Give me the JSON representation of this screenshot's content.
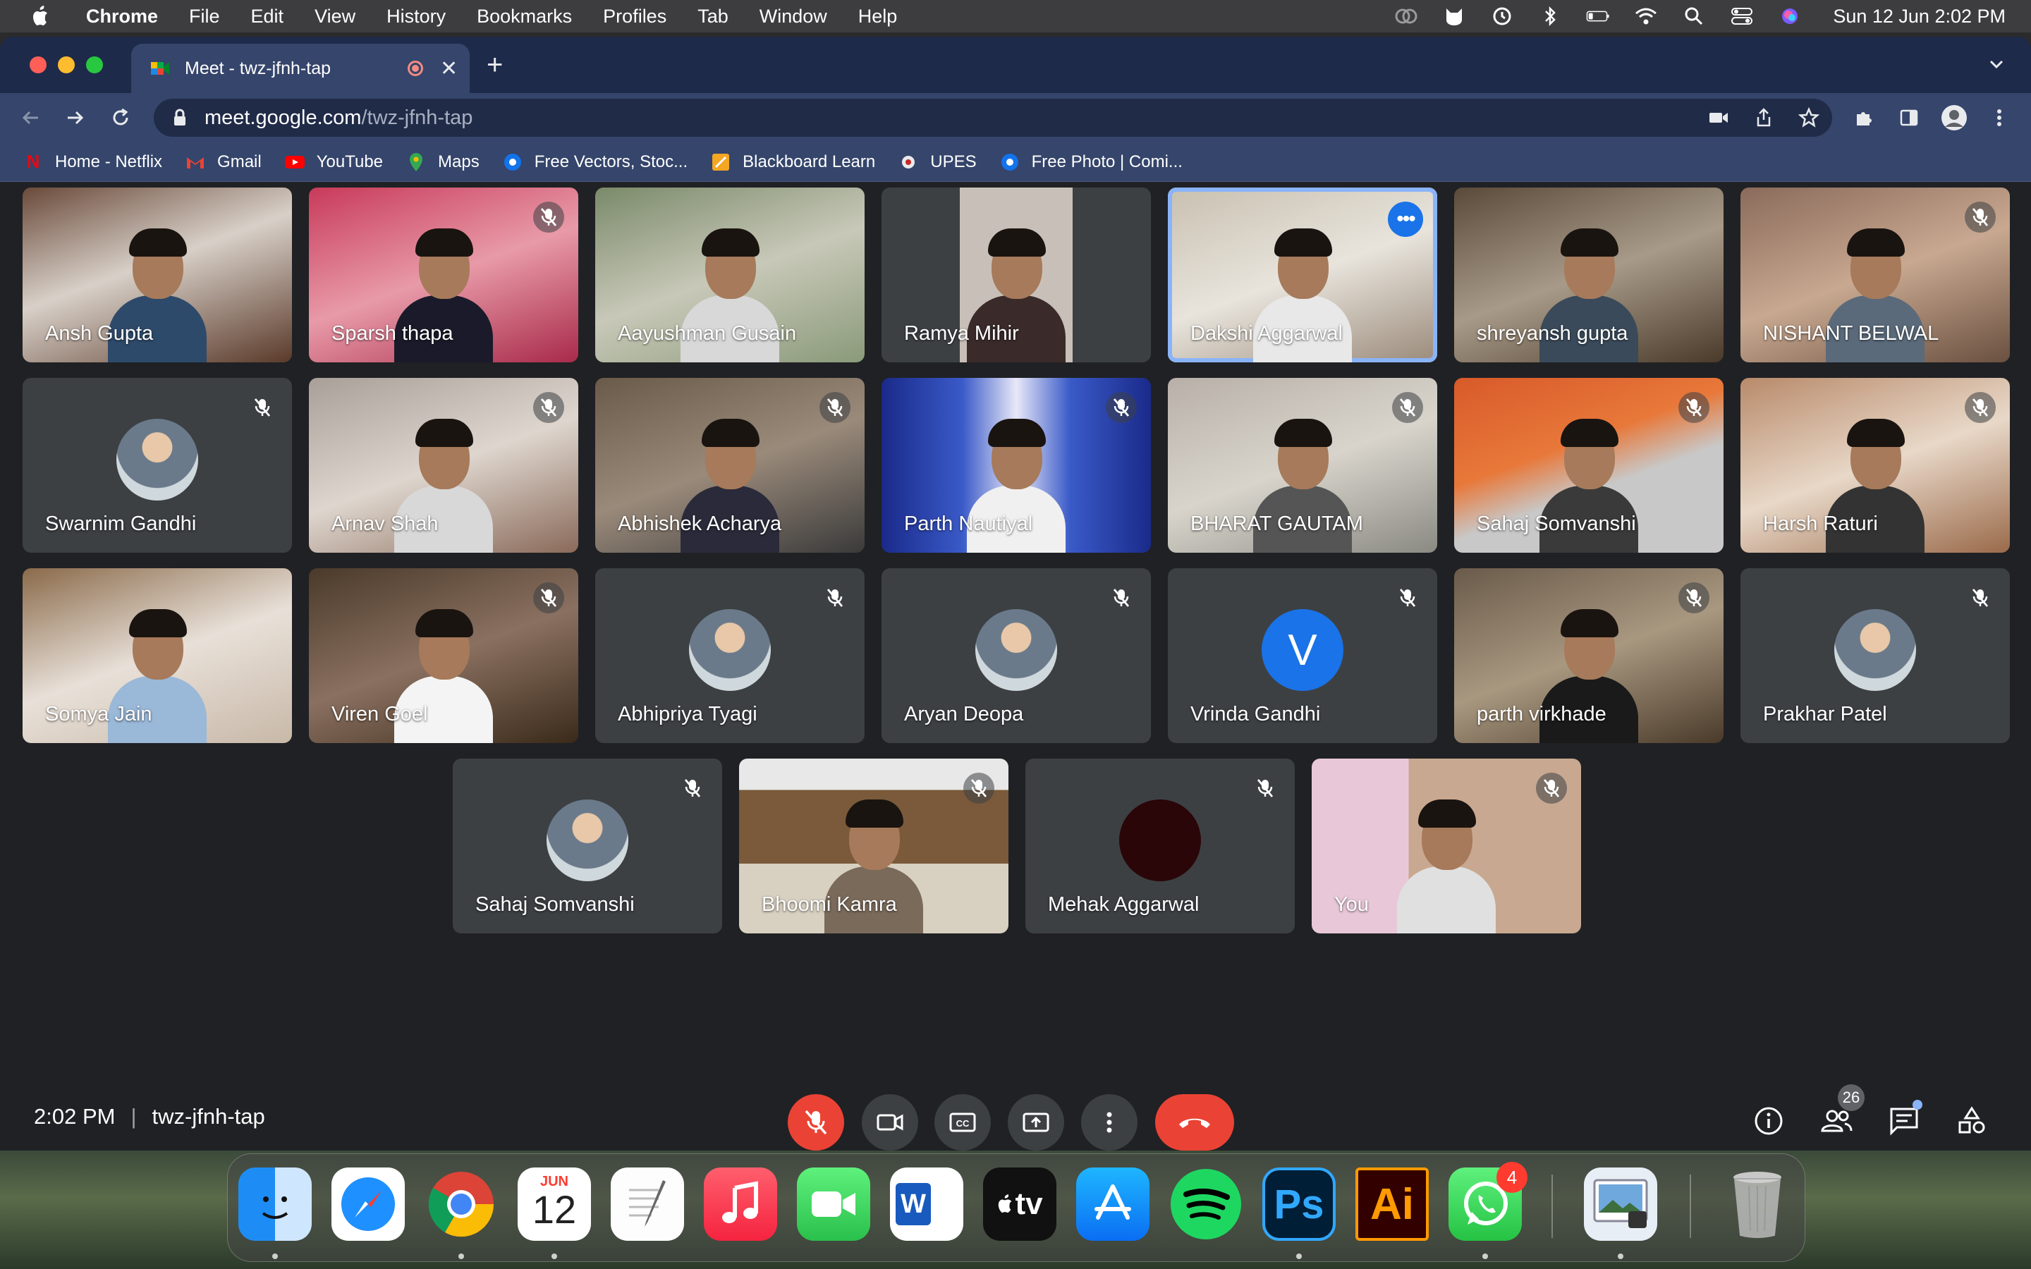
{
  "menubar": {
    "app": "Chrome",
    "items": [
      "File",
      "Edit",
      "View",
      "History",
      "Bookmarks",
      "Profiles",
      "Tab",
      "Window",
      "Help"
    ],
    "clock": "Sun 12 Jun  2:02 PM"
  },
  "browser": {
    "tab_title": "Meet - twz-jfnh-tap",
    "url_host": "meet.google.com",
    "url_path": "/twz-jfnh-tap",
    "bookmarks": [
      {
        "label": "Home - Netflix",
        "icon": "netflix-icon"
      },
      {
        "label": "Gmail",
        "icon": "gmail-icon"
      },
      {
        "label": "YouTube",
        "icon": "youtube-icon"
      },
      {
        "label": "Maps",
        "icon": "maps-icon"
      },
      {
        "label": "Free Vectors, Stoc...",
        "icon": "freepik-icon"
      },
      {
        "label": "Blackboard Learn",
        "icon": "blackboard-icon"
      },
      {
        "label": "UPES",
        "icon": "upes-icon"
      },
      {
        "label": "Free Photo | Comi...",
        "icon": "freepik-icon"
      }
    ]
  },
  "meet": {
    "participants": [
      {
        "name": "Ansh Gupta"
      },
      {
        "name": "Sparsh thapa"
      },
      {
        "name": "Aayushman Gusain"
      },
      {
        "name": "Ramya Mihir"
      },
      {
        "name": "Dakshi Aggarwal"
      },
      {
        "name": "shreyansh gupta"
      },
      {
        "name": "NISHANT BELWAL"
      },
      {
        "name": "Swarnim Gandhi"
      },
      {
        "name": "Arnav Shah"
      },
      {
        "name": "Abhishek Acharya"
      },
      {
        "name": "Parth Nautiyal"
      },
      {
        "name": "BHARAT GAUTAM"
      },
      {
        "name": "Sahaj Somvanshi"
      },
      {
        "name": "Harsh Raturi"
      },
      {
        "name": "Somya Jain"
      },
      {
        "name": "Viren Goel"
      },
      {
        "name": "Abhipriya Tyagi"
      },
      {
        "name": "Aryan Deopa"
      },
      {
        "name": "Vrinda Gandhi",
        "initial": "V"
      },
      {
        "name": "parth virkhade"
      },
      {
        "name": "Prakhar Patel"
      },
      {
        "name": "Sahaj Somvanshi"
      },
      {
        "name": "Bhoomi Kamra"
      },
      {
        "name": "Mehak Aggarwal"
      },
      {
        "name": "You"
      }
    ],
    "time": "2:02 PM",
    "code": "twz-jfnh-tap",
    "people_count": "26"
  },
  "dock": {
    "calendar_month": "JUN",
    "calendar_day": "12",
    "tv_label": "tv",
    "ps_label": "Ps",
    "ai_label": "Ai",
    "word_label": "W",
    "whatsapp_badge": "4"
  }
}
